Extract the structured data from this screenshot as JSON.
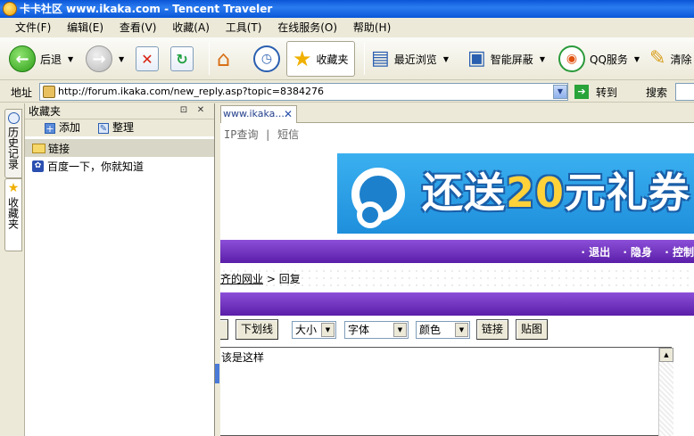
{
  "window": {
    "title": "卡卡社区 www.ikaka.com - Tencent Traveler"
  },
  "menu": [
    "文件(F)",
    "编辑(E)",
    "查看(V)",
    "收藏(A)",
    "工具(T)",
    "在线服务(O)",
    "帮助(H)"
  ],
  "toolbar": {
    "back_label": "后退",
    "favorites_label": "收藏夹",
    "recent_label": "最近浏览",
    "block_label": "智能屏蔽",
    "qq_label": "QQ服务",
    "clear_label": "清除"
  },
  "address": {
    "label": "地址",
    "url": "http://forum.ikaka.com/new_reply.asp?topic=8384276",
    "go_label": "转到",
    "search_label": "搜索"
  },
  "sidetabs": {
    "history": "历史记录",
    "favorites": "收藏夹"
  },
  "favorites_panel": {
    "title": "收藏夹",
    "add_label": "添加",
    "organize_label": "整理",
    "items": [
      {
        "label": "链接",
        "type": "folder"
      },
      {
        "label": "百度一下，你就知道",
        "type": "link"
      }
    ]
  },
  "page": {
    "tab_label": "www.ikaka....",
    "topnav": "IP查询 | 短信",
    "banner_text_a": "还送",
    "banner_text_b": "20",
    "banner_text_c": "元礼券",
    "header_links": [
      "· 退出",
      "· 隐身",
      "· 控制"
    ],
    "breadcrumb_link": "齐的网业",
    "breadcrumb_sep": ">",
    "breadcrumb_current": "回复",
    "editor_buttons": {
      "left_partial": "：",
      "underline": "下划线",
      "link": "链接",
      "paste_image": "贴图"
    },
    "editor_selects": {
      "size": "大小",
      "font": "字体",
      "color": "颜色"
    },
    "editor_text": "该是这样"
  }
}
